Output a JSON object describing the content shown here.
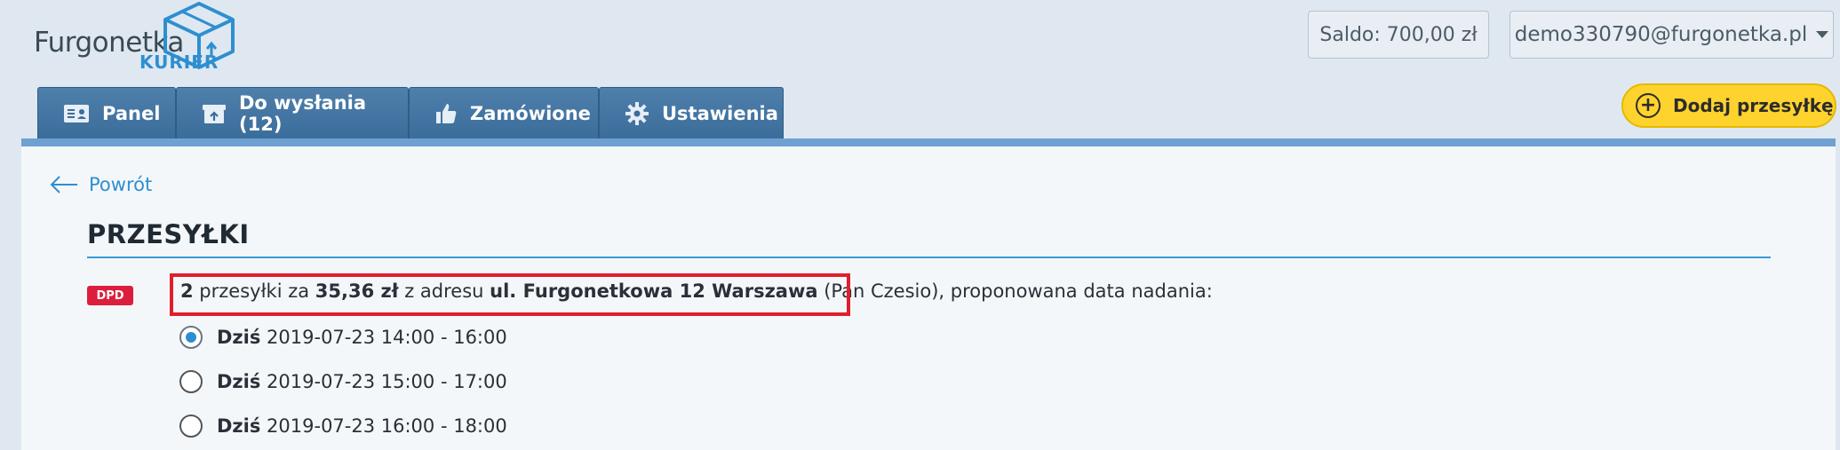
{
  "brand": {
    "name": "Furgonetka",
    "sub": "KURIER"
  },
  "header": {
    "saldo": "Saldo: 700,00 zł",
    "account": "demo330790@furgonetka.pl"
  },
  "tabs": [
    {
      "label": "Panel",
      "icon": "id-card-icon"
    },
    {
      "label": "Do wysłania (12)",
      "icon": "upload-box-icon"
    },
    {
      "label": "Zamówione",
      "icon": "thumbs-up-icon"
    },
    {
      "label": "Ustawienia",
      "icon": "gear-icon"
    }
  ],
  "add_button": {
    "label": "Dodaj przesyłkę"
  },
  "back": {
    "label": "Powrót"
  },
  "section": {
    "title": "PRZESYŁKI"
  },
  "shipment": {
    "carrier": "DPD",
    "count": "2",
    "text_1": " przesyłki za ",
    "price": "35,36 zł",
    "text_2": " z adresu ",
    "address": "ul. Furgonetkowa 12 Warszawa",
    "sender": " (Pan Czesio)",
    "text_3": ", proponowana data nadania:"
  },
  "slots": [
    {
      "day": "Dziś",
      "time": "2019-07-23 14:00 - 16:00",
      "selected": true
    },
    {
      "day": "Dziś",
      "time": "2019-07-23 15:00 - 17:00",
      "selected": false
    },
    {
      "day": "Dziś",
      "time": "2019-07-23 16:00 - 18:00",
      "selected": false
    }
  ],
  "colors": {
    "accent": "#2d8fd0",
    "tab": "#4a7aa6",
    "cta": "#ffd32d",
    "carrier_badge": "#dc1e3c",
    "highlight": "#e01e2e"
  }
}
